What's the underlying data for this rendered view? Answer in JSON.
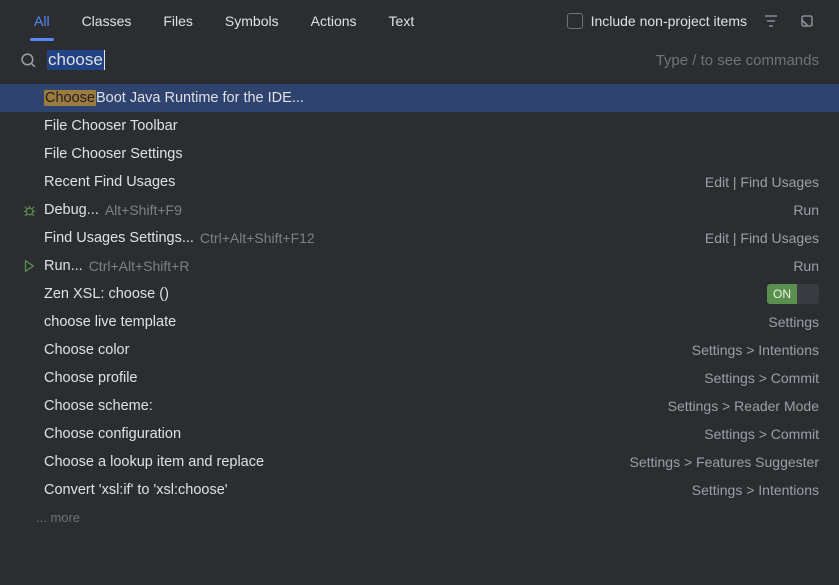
{
  "tabs": {
    "all": "All",
    "classes": "Classes",
    "files": "Files",
    "symbols": "Symbols",
    "actions": "Actions",
    "text": "Text"
  },
  "include_checkbox_label": "Include non-project items",
  "search": {
    "value": "choose",
    "hint": "Type / to see commands"
  },
  "results": [
    {
      "highlight": "Choose",
      "rest": " Boot Java Runtime for the IDE...",
      "right": "",
      "selected": true,
      "icon": ""
    },
    {
      "highlight": "",
      "rest": "File Chooser Toolbar",
      "right": "",
      "icon": ""
    },
    {
      "highlight": "",
      "rest": "File Chooser Settings",
      "right": "",
      "icon": ""
    },
    {
      "highlight": "",
      "rest": "Recent Find Usages",
      "right": "Edit | Find Usages",
      "icon": ""
    },
    {
      "highlight": "",
      "rest": "Debug...",
      "shortcut": "Alt+Shift+F9",
      "right": "Run",
      "icon": "bug"
    },
    {
      "highlight": "",
      "rest": "Find Usages Settings...",
      "shortcut": "Ctrl+Alt+Shift+F12",
      "right": "Edit | Find Usages",
      "icon": ""
    },
    {
      "highlight": "",
      "rest": "Run...",
      "shortcut": "Ctrl+Alt+Shift+R",
      "right": "Run",
      "icon": "run"
    },
    {
      "highlight": "",
      "rest": "Zen XSL: choose ()",
      "right": "",
      "toggle": "ON",
      "icon": ""
    },
    {
      "highlight": "",
      "rest": "choose live template",
      "right": "Settings",
      "icon": ""
    },
    {
      "highlight": "",
      "rest": "Choose color",
      "right": "Settings > Intentions",
      "icon": ""
    },
    {
      "highlight": "",
      "rest": "Choose profile",
      "right": "Settings > Commit",
      "icon": ""
    },
    {
      "highlight": "",
      "rest": "Choose scheme:",
      "right": "Settings > Reader Mode",
      "icon": ""
    },
    {
      "highlight": "",
      "rest": "Choose configuration",
      "right": "Settings > Commit",
      "icon": ""
    },
    {
      "highlight": "",
      "rest": "Choose a lookup item and replace",
      "right": "Settings > Features Suggester",
      "icon": ""
    },
    {
      "highlight": "",
      "rest": "Convert 'xsl:if' to 'xsl:choose'",
      "right": "Settings > Intentions",
      "icon": ""
    }
  ],
  "more_label": "... more"
}
